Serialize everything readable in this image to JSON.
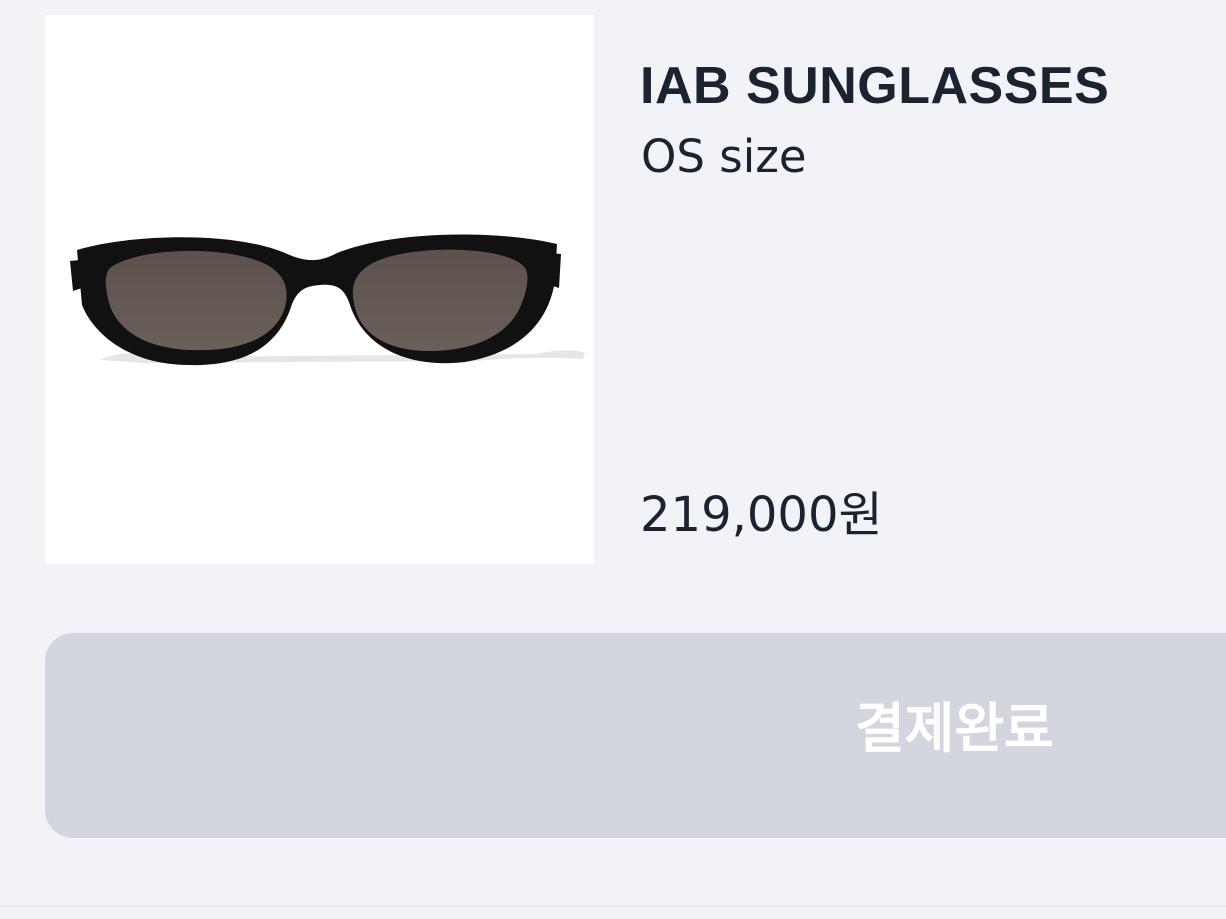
{
  "product": {
    "title": "IAB SUNGLASSES",
    "size": "OS size",
    "price": "219,000원",
    "image_icon": "sunglasses-image"
  },
  "actions": {
    "complete_label": "결제완료"
  },
  "colors": {
    "page_background": "#f2f3f6",
    "image_background": "#ffffff",
    "text_primary": "#1b2230",
    "button_background": "#d3d6de",
    "button_text": "#ffffff",
    "frame": "#111111",
    "lens": "#5f5550"
  }
}
